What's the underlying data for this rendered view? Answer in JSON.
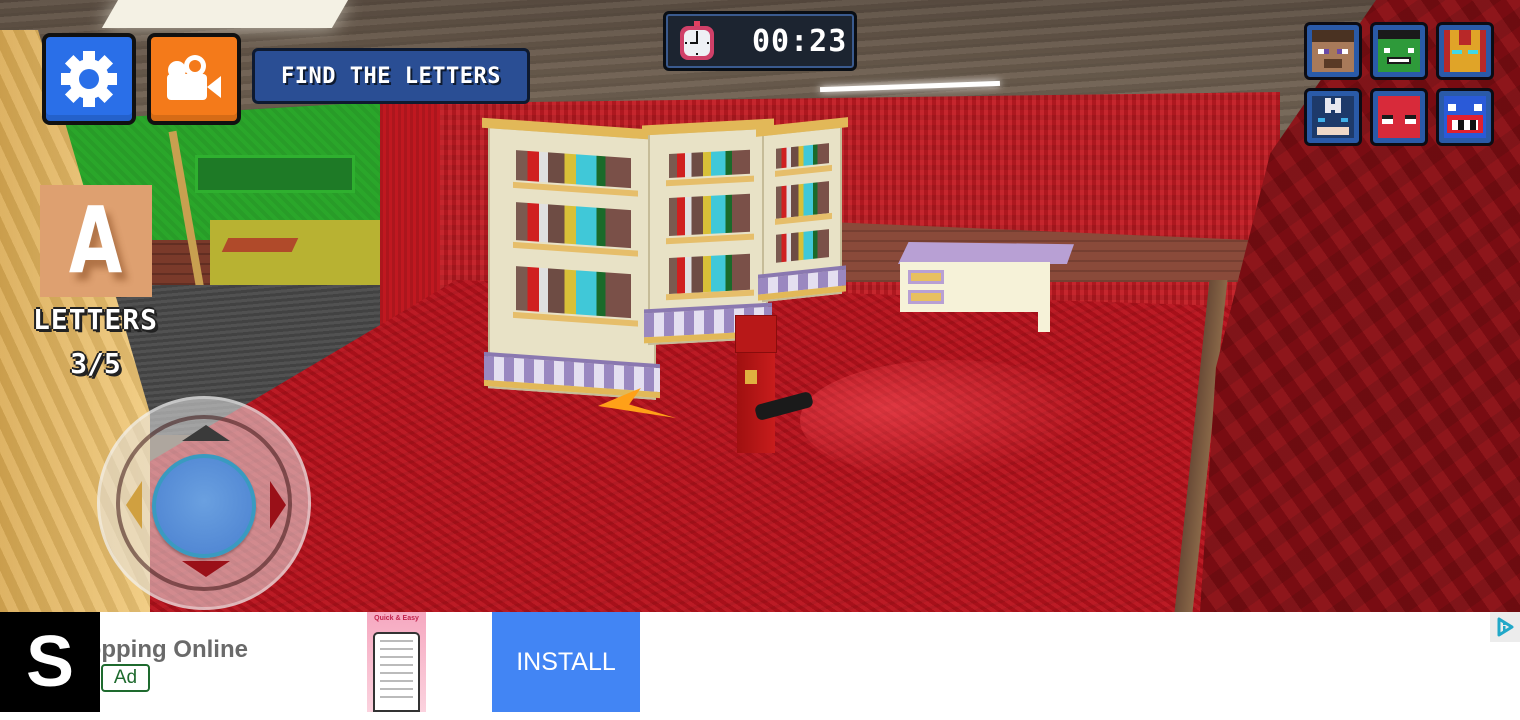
{
  "hud": {
    "settings_button": {
      "icon": "gear-icon",
      "color": "#2a6fe8"
    },
    "record_button": {
      "icon": "video-camera-icon",
      "color": "#f47a1a"
    },
    "objective": "FIND THE LETTERS",
    "timer": {
      "icon": "stopwatch-icon",
      "value": "00:23"
    },
    "letter_card": {
      "letter": "A"
    },
    "letters_label": "LETTERS",
    "letters_count": "3/5",
    "letters_progress": {
      "found": 3,
      "total": 5
    },
    "joystick": {
      "directions": [
        "up",
        "down",
        "left",
        "right"
      ]
    },
    "characters": [
      {
        "name": "steve",
        "icon": "steve-face-icon"
      },
      {
        "name": "hulk",
        "icon": "hulk-face-icon"
      },
      {
        "name": "iron-man",
        "icon": "iron-man-face-icon"
      },
      {
        "name": "captain-america",
        "icon": "captain-america-face-icon"
      },
      {
        "name": "spider-man",
        "icon": "spider-man-face-icon"
      },
      {
        "name": "huggy-monster",
        "icon": "monster-face-icon"
      }
    ]
  },
  "ad": {
    "logo_letter": "S",
    "title_partial": "Shopping Online",
    "badge": "Ad",
    "thumbnail_title": "Quick & Easy",
    "install_label": "INSTALL",
    "install_color": "#4285f4",
    "adchoices_icon": "adchoices-icon"
  }
}
